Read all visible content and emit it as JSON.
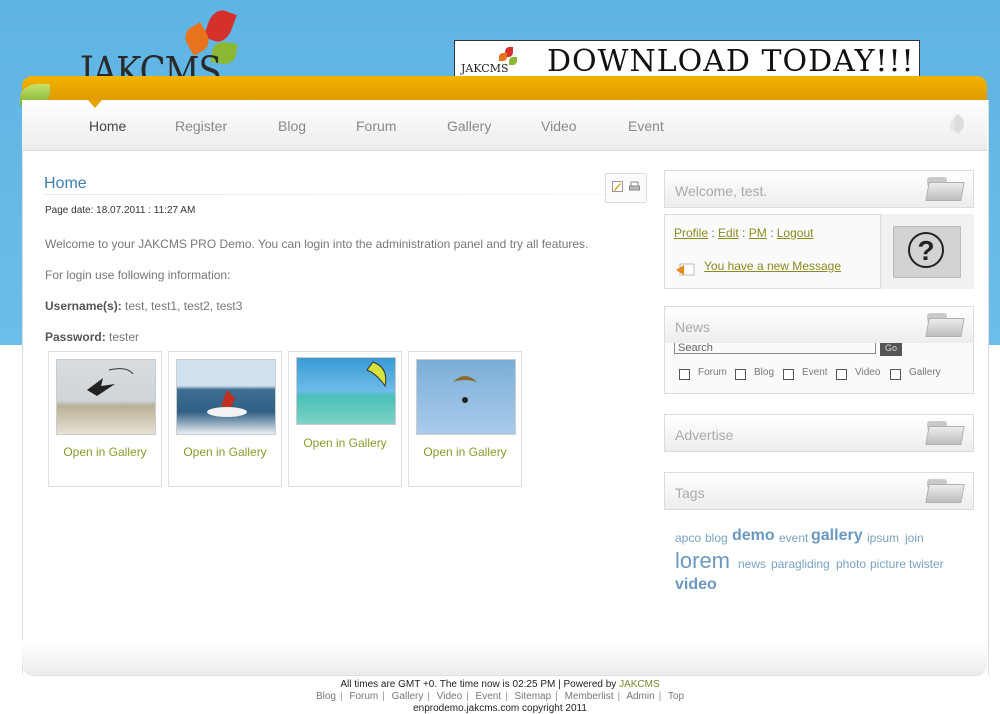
{
  "brand": {
    "logo_text": "JAKCMS"
  },
  "banner": {
    "mini_logo": "JAKCMS",
    "text": "DOWNLOAD TODAY!!!"
  },
  "nav": {
    "items": [
      "Home",
      "Register",
      "Blog",
      "Forum",
      "Gallery",
      "Video",
      "Event"
    ],
    "active": "Home"
  },
  "main": {
    "title": "Home",
    "page_date": "Page date: 18.07.2011 : 11:27 AM",
    "welcome": "Welcome to your JAKCMS PRO Demo. You can login into the administration panel and try all features.",
    "login_info": "For login use following information:",
    "username_label": "Username(s):",
    "username_value": "test, test1, test2, test3",
    "password_label": "Password:",
    "password_value": "tester",
    "gallery": [
      {
        "caption": "Open in Gallery"
      },
      {
        "caption": "Open in Gallery"
      },
      {
        "caption": "Open in Gallery"
      },
      {
        "caption": "Open in Gallery"
      }
    ]
  },
  "sidebar": {
    "welcome_title": "Welcome, test.",
    "links": [
      "Profile",
      "Edit",
      "PM",
      "Logout"
    ],
    "new_message": "You have a new Message",
    "news_title": "News",
    "search_placeholder": "Search",
    "search_button": "Go",
    "filters": [
      "Forum",
      "Blog",
      "Event",
      "Video",
      "Gallery"
    ],
    "advertise_title": "Advertise",
    "tags_title": "Tags",
    "tags": [
      "apco",
      "blog",
      "demo",
      "event",
      "gallery",
      "ipsum",
      "join",
      "lorem",
      "news",
      "paragliding",
      "photo",
      "picture",
      "twister",
      "video"
    ]
  },
  "footer": {
    "time_prefix": "All times are GMT +0. The time now is 02:25 PM |  Powered by",
    "powered_by": "JAKCMS",
    "links": [
      "Blog",
      "Forum",
      "Gallery",
      "Video",
      "Event",
      "Sitemap",
      "Memberlist",
      "Admin",
      "Top"
    ],
    "copyright": "enprodemo.jakcms.com copyright 2011"
  },
  "colors": {
    "sky": "#5eb4e4",
    "gold": "#f3b400",
    "link_olive": "#8a9a2a",
    "title_blue": "#3e7fb0"
  }
}
